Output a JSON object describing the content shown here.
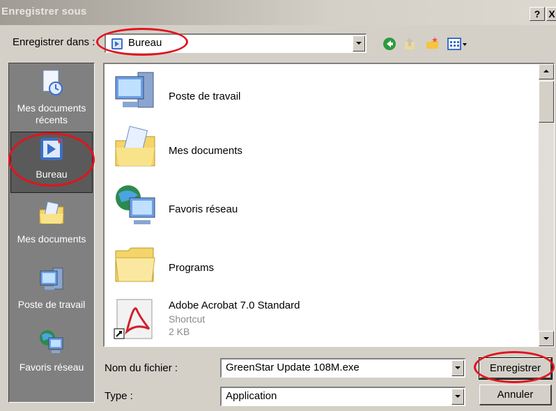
{
  "window": {
    "title": "Enregistrer sous",
    "help_label": "?",
    "close_label": "X"
  },
  "toolbar": {
    "save_in_label": "Enregistrer dans :",
    "location": "Bureau",
    "icons": [
      "back-arrow-icon",
      "up-folder-icon",
      "new-folder-icon",
      "view-menu-icon"
    ]
  },
  "places": [
    {
      "label": "Mes documents récents",
      "icon": "recent-documents-icon"
    },
    {
      "label": "Bureau",
      "icon": "desktop-icon",
      "selected": true
    },
    {
      "label": "Mes documents",
      "icon": "my-documents-icon"
    },
    {
      "label": "Poste de travail",
      "icon": "my-computer-icon"
    },
    {
      "label": "Favoris réseau",
      "icon": "network-places-icon"
    }
  ],
  "files": [
    {
      "name": "Poste de travail",
      "icon": "my-computer-icon"
    },
    {
      "name": "Mes documents",
      "icon": "my-documents-icon"
    },
    {
      "name": "Favoris réseau",
      "icon": "network-places-icon"
    },
    {
      "name": "Programs",
      "icon": "folder-icon"
    },
    {
      "name": "Adobe Acrobat 7.0 Standard",
      "icon": "acrobat-shortcut-icon",
      "type": "Shortcut",
      "size": "2 KB"
    }
  ],
  "form": {
    "filename_label": "Nom du fichier :",
    "filename_value": "GreenStar Update 108M.exe",
    "type_label": "Type :",
    "type_value": "Application",
    "save_button": "Enregistrer",
    "cancel_button": "Annuler"
  },
  "colors": {
    "highlight_oval": "#e0141e",
    "places_bar": "#808080",
    "dialog": "#d4d0c8"
  }
}
